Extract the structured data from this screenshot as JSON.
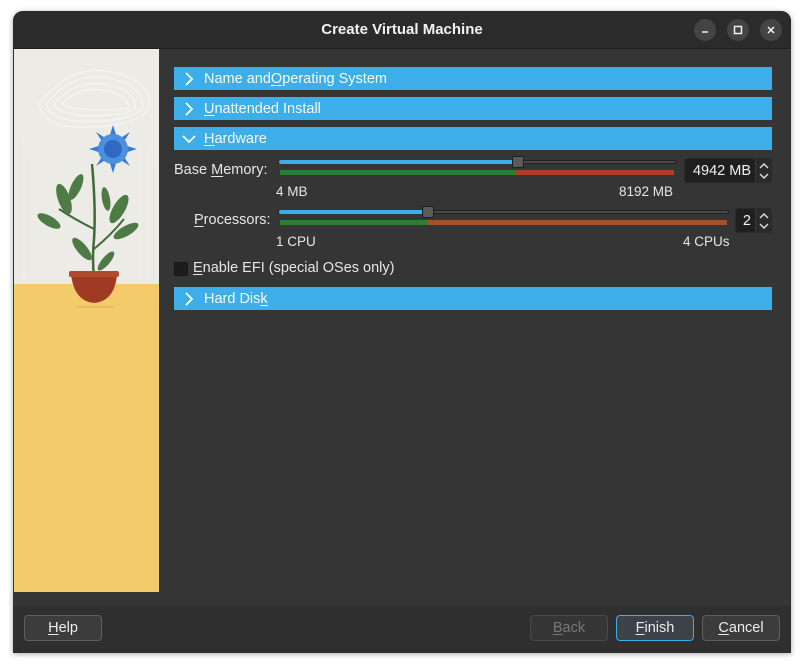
{
  "window": {
    "title": "Create Virtual Machine",
    "controls": [
      "minimize-icon",
      "maximize-icon",
      "close-icon"
    ]
  },
  "sections": {
    "name_os": {
      "pre": "Name and ",
      "accel": "O",
      "post": "perating System",
      "expanded": false
    },
    "unattended": {
      "pre": "",
      "accel": "U",
      "post": "nattended Install",
      "expanded": false
    },
    "hardware": {
      "pre": "",
      "accel": "H",
      "post": "ardware",
      "expanded": true
    },
    "hard_disk": {
      "pre": "Hard Dis",
      "accel": "k",
      "post": "",
      "expanded": false
    }
  },
  "hardware": {
    "memory": {
      "label_pre": "Base ",
      "label_accel": "M",
      "label_post": "emory:",
      "value_text": "4942 MB",
      "value": 4942,
      "min": 4,
      "max": 8192,
      "min_label": "4 MB",
      "max_label": "8192 MB",
      "recommended_fraction": 0.6
    },
    "processors": {
      "label_pre": "",
      "label_accel": "P",
      "label_post": "rocessors:",
      "value_text": "2",
      "value": 2,
      "min": 1,
      "max": 4,
      "min_label": "1 CPU",
      "max_label": "4 CPUs",
      "recommended_fraction": 0.33
    },
    "efi": {
      "accel": "E",
      "label_post": "nable EFI (special OSes only)",
      "checked": false
    }
  },
  "buttons": {
    "help": {
      "accel": "H",
      "post": "elp"
    },
    "back": {
      "accel": "B",
      "post": "ack",
      "enabled": false
    },
    "finish": {
      "accel": "F",
      "post": "inish"
    },
    "cancel": {
      "accel": "C",
      "post": "ancel"
    }
  },
  "colors": {
    "accent": "#3daee9",
    "ok_range": "#2e7d32",
    "warn_range": "#a0522d",
    "bad_range": "#b03a2e"
  }
}
